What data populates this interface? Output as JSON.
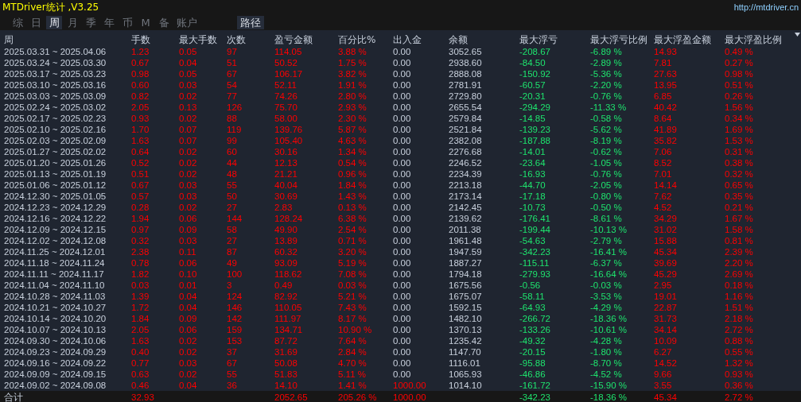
{
  "window": {
    "title": "MTDriver统计 ,V3.25",
    "link": "http://mtdriver.cn"
  },
  "tabs": [
    {
      "label": "综",
      "selected": false
    },
    {
      "label": "日",
      "selected": false
    },
    {
      "label": "周",
      "selected": true
    },
    {
      "label": "月",
      "selected": false
    },
    {
      "label": "季",
      "selected": false
    },
    {
      "label": "年",
      "selected": false
    },
    {
      "label": "币",
      "selected": false
    },
    {
      "label": "M",
      "selected": false
    },
    {
      "label": "备",
      "selected": false
    },
    {
      "label": "账户",
      "selected": false
    }
  ],
  "path_button": {
    "label": "路径"
  },
  "table": {
    "columns": [
      {
        "label": "周",
        "kind": "plain"
      },
      {
        "label": "手数",
        "kind": "up"
      },
      {
        "label": "最大手数",
        "kind": "up"
      },
      {
        "label": "次数",
        "kind": "up"
      },
      {
        "label": "盈亏金额",
        "kind": "up"
      },
      {
        "label": "百分比%",
        "kind": "up"
      },
      {
        "label": "出入金",
        "kind": "deposit"
      },
      {
        "label": "余额",
        "kind": "plain"
      },
      {
        "label": "最大浮亏",
        "kind": "down"
      },
      {
        "label": "最大浮亏比例",
        "kind": "down"
      },
      {
        "label": "最大浮盈金额",
        "kind": "up"
      },
      {
        "label": "最大浮盈比例",
        "kind": "up"
      }
    ],
    "rows": [
      {
        "deposit_flagged": false,
        "cells": [
          "2025.03.31 ~ 2025.04.06",
          "1.23",
          "0.05",
          "97",
          "114.05",
          "3.88 %",
          "0.00",
          "3052.65",
          "-208.67",
          "-6.89 %",
          "14.93",
          "0.49 %"
        ]
      },
      {
        "deposit_flagged": false,
        "cells": [
          "2025.03.24 ~ 2025.03.30",
          "0.67",
          "0.04",
          "51",
          "50.52",
          "1.75 %",
          "0.00",
          "2938.60",
          "-84.50",
          "-2.89 %",
          "7.81",
          "0.27 %"
        ]
      },
      {
        "deposit_flagged": false,
        "cells": [
          "2025.03.17 ~ 2025.03.23",
          "0.98",
          "0.05",
          "67",
          "106.17",
          "3.82 %",
          "0.00",
          "2888.08",
          "-150.92",
          "-5.36 %",
          "27.63",
          "0.98 %"
        ]
      },
      {
        "deposit_flagged": false,
        "cells": [
          "2025.03.10 ~ 2025.03.16",
          "0.60",
          "0.03",
          "54",
          "52.11",
          "1.91 %",
          "0.00",
          "2781.91",
          "-60.57",
          "-2.20 %",
          "13.95",
          "0.51 %"
        ]
      },
      {
        "deposit_flagged": false,
        "cells": [
          "2025.03.03 ~ 2025.03.09",
          "0.82",
          "0.02",
          "77",
          "74.26",
          "2.80 %",
          "0.00",
          "2729.80",
          "-20.31",
          "-0.76 %",
          "6.85",
          "0.26 %"
        ]
      },
      {
        "deposit_flagged": false,
        "cells": [
          "2025.02.24 ~ 2025.03.02",
          "2.05",
          "0.13",
          "126",
          "75.70",
          "2.93 %",
          "0.00",
          "2655.54",
          "-294.29",
          "-11.33 %",
          "40.42",
          "1.56 %"
        ]
      },
      {
        "deposit_flagged": false,
        "cells": [
          "2025.02.17 ~ 2025.02.23",
          "0.93",
          "0.02",
          "88",
          "58.00",
          "2.30 %",
          "0.00",
          "2579.84",
          "-14.85",
          "-0.58 %",
          "8.64",
          "0.34 %"
        ]
      },
      {
        "deposit_flagged": false,
        "cells": [
          "2025.02.10 ~ 2025.02.16",
          "1.70",
          "0.07",
          "119",
          "139.76",
          "5.87 %",
          "0.00",
          "2521.84",
          "-139.23",
          "-5.62 %",
          "41.89",
          "1.69 %"
        ]
      },
      {
        "deposit_flagged": false,
        "cells": [
          "2025.02.03 ~ 2025.02.09",
          "1.63",
          "0.07",
          "99",
          "105.40",
          "4.63 %",
          "0.00",
          "2382.08",
          "-187.88",
          "-8.19 %",
          "35.82",
          "1.53 %"
        ]
      },
      {
        "deposit_flagged": false,
        "cells": [
          "2025.01.27 ~ 2025.02.02",
          "0.64",
          "0.02",
          "60",
          "30.16",
          "1.34 %",
          "0.00",
          "2276.68",
          "-14.01",
          "-0.62 %",
          "7.06",
          "0.31 %"
        ]
      },
      {
        "deposit_flagged": false,
        "cells": [
          "2025.01.20 ~ 2025.01.26",
          "0.52",
          "0.02",
          "44",
          "12.13",
          "0.54 %",
          "0.00",
          "2246.52",
          "-23.64",
          "-1.05 %",
          "8.52",
          "0.38 %"
        ]
      },
      {
        "deposit_flagged": false,
        "cells": [
          "2025.01.13 ~ 2025.01.19",
          "0.51",
          "0.02",
          "48",
          "21.21",
          "0.96 %",
          "0.00",
          "2234.39",
          "-16.93",
          "-0.76 %",
          "7.01",
          "0.32 %"
        ]
      },
      {
        "deposit_flagged": false,
        "cells": [
          "2025.01.06 ~ 2025.01.12",
          "0.67",
          "0.03",
          "55",
          "40.04",
          "1.84 %",
          "0.00",
          "2213.18",
          "-44.70",
          "-2.05 %",
          "14.14",
          "0.65 %"
        ]
      },
      {
        "deposit_flagged": false,
        "cells": [
          "2024.12.30 ~ 2025.01.05",
          "0.57",
          "0.03",
          "50",
          "30.69",
          "1.43 %",
          "0.00",
          "2173.14",
          "-17.18",
          "-0.80 %",
          "7.62",
          "0.35 %"
        ]
      },
      {
        "deposit_flagged": false,
        "cells": [
          "2024.12.23 ~ 2024.12.29",
          "0.28",
          "0.02",
          "27",
          "2.83",
          "0.13 %",
          "0.00",
          "2142.45",
          "-10.73",
          "-0.50 %",
          "4.52",
          "0.21 %"
        ]
      },
      {
        "deposit_flagged": false,
        "cells": [
          "2024.12.16 ~ 2024.12.22",
          "1.94",
          "0.06",
          "144",
          "128.24",
          "6.38 %",
          "0.00",
          "2139.62",
          "-176.41",
          "-8.61 %",
          "34.29",
          "1.67 %"
        ]
      },
      {
        "deposit_flagged": false,
        "cells": [
          "2024.12.09 ~ 2024.12.15",
          "0.97",
          "0.09",
          "58",
          "49.90",
          "2.54 %",
          "0.00",
          "2011.38",
          "-199.44",
          "-10.13 %",
          "31.02",
          "1.58 %"
        ]
      },
      {
        "deposit_flagged": false,
        "cells": [
          "2024.12.02 ~ 2024.12.08",
          "0.32",
          "0.03",
          "27",
          "13.89",
          "0.71 %",
          "0.00",
          "1961.48",
          "-54.63",
          "-2.79 %",
          "15.88",
          "0.81 %"
        ]
      },
      {
        "deposit_flagged": false,
        "cells": [
          "2024.11.25 ~ 2024.12.01",
          "2.38",
          "0.11",
          "87",
          "60.32",
          "3.20 %",
          "0.00",
          "1947.59",
          "-342.23",
          "-16.41 %",
          "45.34",
          "2.39 %"
        ]
      },
      {
        "deposit_flagged": false,
        "cells": [
          "2024.11.18 ~ 2024.11.24",
          "0.78",
          "0.06",
          "49",
          "93.09",
          "5.19 %",
          "0.00",
          "1887.27",
          "-115.11",
          "-6.37 %",
          "39.69",
          "2.20 %"
        ]
      },
      {
        "deposit_flagged": false,
        "cells": [
          "2024.11.11 ~ 2024.11.17",
          "1.82",
          "0.10",
          "100",
          "118.62",
          "7.08 %",
          "0.00",
          "1794.18",
          "-279.93",
          "-16.64 %",
          "45.29",
          "2.69 %"
        ]
      },
      {
        "deposit_flagged": false,
        "cells": [
          "2024.11.04 ~ 2024.11.10",
          "0.03",
          "0.01",
          "3",
          "0.49",
          "0.03 %",
          "0.00",
          "1675.56",
          "-0.56",
          "-0.03 %",
          "2.95",
          "0.18 %"
        ]
      },
      {
        "deposit_flagged": false,
        "cells": [
          "2024.10.28 ~ 2024.11.03",
          "1.39",
          "0.04",
          "124",
          "82.92",
          "5.21 %",
          "0.00",
          "1675.07",
          "-58.11",
          "-3.53 %",
          "19.01",
          "1.16 %"
        ]
      },
      {
        "deposit_flagged": false,
        "cells": [
          "2024.10.21 ~ 2024.10.27",
          "1.72",
          "0.04",
          "146",
          "110.05",
          "7.43 %",
          "0.00",
          "1592.15",
          "-64.93",
          "-4.29 %",
          "22.87",
          "1.51 %"
        ]
      },
      {
        "deposit_flagged": false,
        "cells": [
          "2024.10.14 ~ 2024.10.20",
          "1.84",
          "0.09",
          "142",
          "111.97",
          "8.17 %",
          "0.00",
          "1482.10",
          "-266.72",
          "-18.36 %",
          "31.73",
          "2.18 %"
        ]
      },
      {
        "deposit_flagged": false,
        "cells": [
          "2024.10.07 ~ 2024.10.13",
          "2.05",
          "0.06",
          "159",
          "134.71",
          "10.90 %",
          "0.00",
          "1370.13",
          "-133.26",
          "-10.61 %",
          "34.14",
          "2.72 %"
        ]
      },
      {
        "deposit_flagged": false,
        "cells": [
          "2024.09.30 ~ 2024.10.06",
          "1.63",
          "0.02",
          "153",
          "87.72",
          "7.64 %",
          "0.00",
          "1235.42",
          "-49.32",
          "-4.28 %",
          "10.09",
          "0.88 %"
        ]
      },
      {
        "deposit_flagged": false,
        "cells": [
          "2024.09.23 ~ 2024.09.29",
          "0.40",
          "0.02",
          "37",
          "31.69",
          "2.84 %",
          "0.00",
          "1147.70",
          "-20.15",
          "-1.80 %",
          "6.27",
          "0.55 %"
        ]
      },
      {
        "deposit_flagged": false,
        "cells": [
          "2024.09.16 ~ 2024.09.22",
          "0.77",
          "0.03",
          "67",
          "50.08",
          "4.70 %",
          "0.00",
          "1116.01",
          "-95.88",
          "-8.70 %",
          "14.52",
          "1.32 %"
        ]
      },
      {
        "deposit_flagged": false,
        "cells": [
          "2024.09.09 ~ 2024.09.15",
          "0.63",
          "0.02",
          "55",
          "51.83",
          "5.11 %",
          "0.00",
          "1065.93",
          "-46.86",
          "-4.52 %",
          "9.66",
          "0.93 %"
        ]
      },
      {
        "deposit_flagged": true,
        "cells": [
          "2024.09.02 ~ 2024.09.08",
          "0.46",
          "0.04",
          "36",
          "14.10",
          "1.41 %",
          "1000.00",
          "1014.10",
          "-161.72",
          "-15.90 %",
          "3.55",
          "0.36 %"
        ]
      }
    ],
    "total": {
      "deposit_flagged": true,
      "cells": [
        "合计",
        "32.93",
        null,
        null,
        "2052.65",
        "205.26 %",
        "1000.00",
        null,
        "-342.23",
        "-18.36 %",
        "45.34",
        "2.72 %"
      ]
    }
  }
}
